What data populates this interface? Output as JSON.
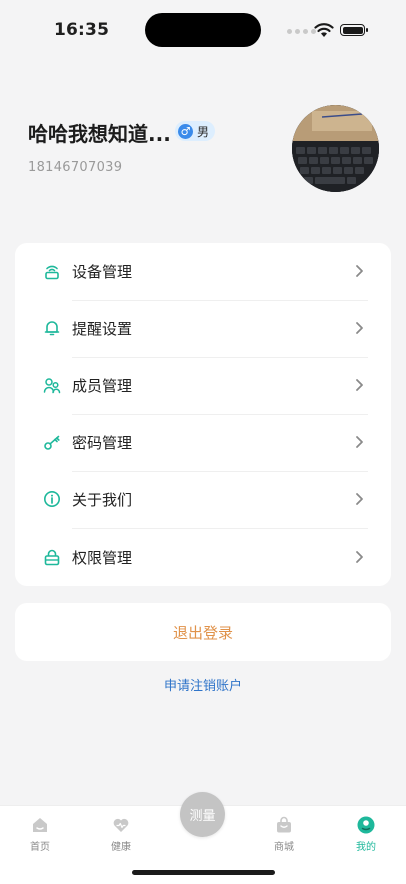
{
  "status_bar": {
    "time": "16:35"
  },
  "profile": {
    "name": "哈哈我想知道...",
    "gender_symbol": "♂",
    "gender": "男",
    "phone": "18146707039"
  },
  "menu": [
    {
      "label": "设备管理",
      "icon": "router-icon"
    },
    {
      "label": "提醒设置",
      "icon": "bell-icon"
    },
    {
      "label": "成员管理",
      "icon": "members-icon"
    },
    {
      "label": "密码管理",
      "icon": "key-icon"
    },
    {
      "label": "关于我们",
      "icon": "info-icon"
    },
    {
      "label": "权限管理",
      "icon": "lock-icon"
    }
  ],
  "logout_label": "退出登录",
  "cancel_account_label": "申请注销账户",
  "tabbar": {
    "home": "首页",
    "health": "健康",
    "measure": "测量",
    "mall": "商城",
    "mine": "我的"
  },
  "colors": {
    "accent": "#1eb89b",
    "logout": "#e0924a",
    "link": "#2f74c9",
    "badge_bg": "#ddeefe",
    "gender_icon": "#3b8bea"
  }
}
